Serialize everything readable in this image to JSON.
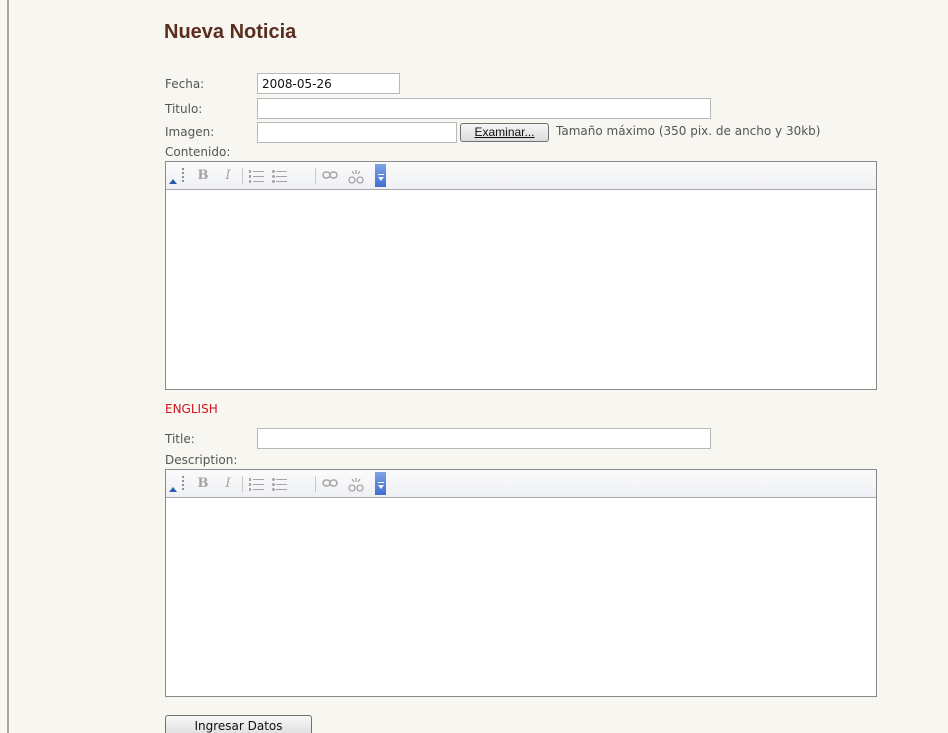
{
  "page": {
    "title": "Nueva Noticia"
  },
  "form": {
    "fecha_label": "Fecha:",
    "fecha_value": "2008-05-26",
    "titulo_label": "Titulo:",
    "titulo_value": "",
    "imagen_label": "Imagen:",
    "imagen_value": "",
    "browse_label": "Examinar...",
    "imagen_hint": "Tamaño máximo (350 pix. de ancho y 30kb)",
    "contenido_label": "Contenido:",
    "english_heading": "ENGLISH",
    "title_label": "Title:",
    "title_value": "",
    "description_label": "Description:",
    "submit_label": "Ingresar Datos"
  },
  "editor_toolbar": {
    "bold": "B",
    "italic": "I",
    "icons": [
      "collapse-icon",
      "grip-icon",
      "bold-icon",
      "italic-icon",
      "ordered-list-icon",
      "unordered-list-icon",
      "link-icon",
      "unlink-icon",
      "more-options-icon"
    ]
  },
  "colors": {
    "title": "#5a2d1e",
    "english_heading": "#d0161c",
    "background": "#f8f6f0",
    "toolbar_more": "#3f6fd2"
  }
}
